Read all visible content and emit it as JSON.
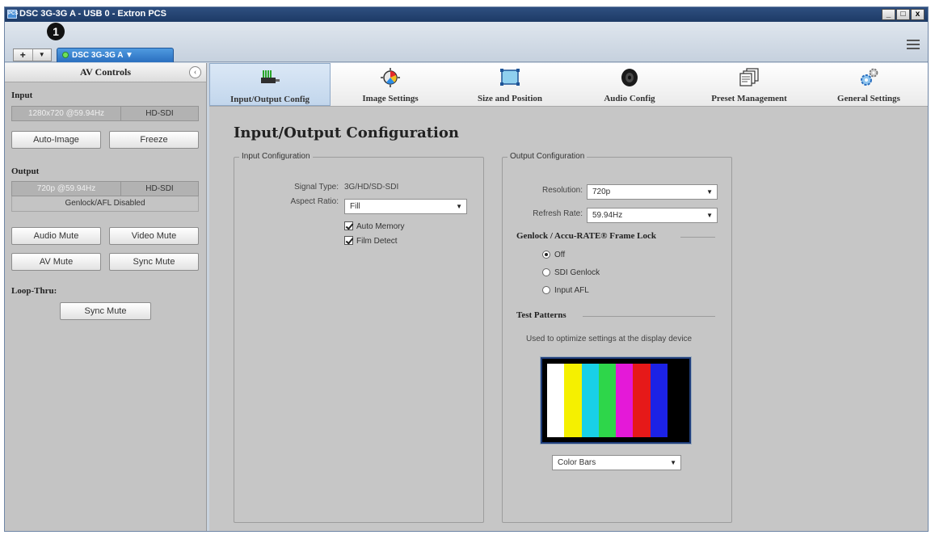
{
  "window": {
    "app_icon": "PCS",
    "title": "DSC 3G-3G A - USB 0 - Extron PCS",
    "minimize": "_",
    "maximize": "□",
    "close": "x"
  },
  "tabstrip": {
    "marker": "1",
    "add": "+",
    "add_dropdown": "▼",
    "device_tab": "DSC 3G-3G A ▼"
  },
  "av_controls": {
    "title": "AV Controls",
    "collapse_icon": "‹",
    "input_label": "Input",
    "input_resolution": "1280x720 @59.94Hz",
    "input_type": "HD-SDI",
    "auto_image": "Auto-Image",
    "freeze": "Freeze",
    "output_label": "Output",
    "output_resolution": "720p @59.94Hz",
    "output_type": "HD-SDI",
    "genlock_status": "Genlock/AFL Disabled",
    "audio_mute": "Audio Mute",
    "video_mute": "Video Mute",
    "av_mute": "AV Mute",
    "sync_mute": "Sync Mute",
    "loop_thru_label": "Loop-Thru:",
    "loop_sync_mute": "Sync Mute"
  },
  "toolbar": [
    {
      "label": "Input/Output Config",
      "icon": "input-output-icon",
      "active": true
    },
    {
      "label": "Image Settings",
      "icon": "image-settings-icon",
      "active": false
    },
    {
      "label": "Size and Position",
      "icon": "size-position-icon",
      "active": false
    },
    {
      "label": "Audio Config",
      "icon": "speaker-icon",
      "active": false
    },
    {
      "label": "Preset Management",
      "icon": "preset-icon",
      "active": false
    },
    {
      "label": "General Settings",
      "icon": "gears-icon",
      "active": false
    }
  ],
  "page": {
    "title": "Input/Output Configuration"
  },
  "input_config": {
    "legend": "Input Configuration",
    "signal_type_label": "Signal Type:",
    "signal_type_value": "3G/HD/SD-SDI",
    "aspect_ratio_label": "Aspect Ratio:",
    "aspect_ratio_value": "Fill",
    "auto_memory": "Auto Memory",
    "film_detect": "Film Detect"
  },
  "output_config": {
    "legend": "Output Configuration",
    "resolution_label": "Resolution:",
    "resolution_value": "720p",
    "refresh_label": "Refresh Rate:",
    "refresh_value": "59.94Hz",
    "genlock_heading": "Genlock / Accu-RATE® Frame Lock",
    "genlock_off": "Off",
    "genlock_sdi": "SDI Genlock",
    "genlock_afl": "Input AFL",
    "test_patterns_heading": "Test Patterns",
    "test_patterns_hint": "Used to optimize settings at the display device",
    "pattern_value": "Color Bars",
    "color_bars": [
      "#ffffff",
      "#f5f000",
      "#19d0e6",
      "#2ed64a",
      "#e419d8",
      "#e61919",
      "#1c22e6",
      "#000000"
    ]
  }
}
